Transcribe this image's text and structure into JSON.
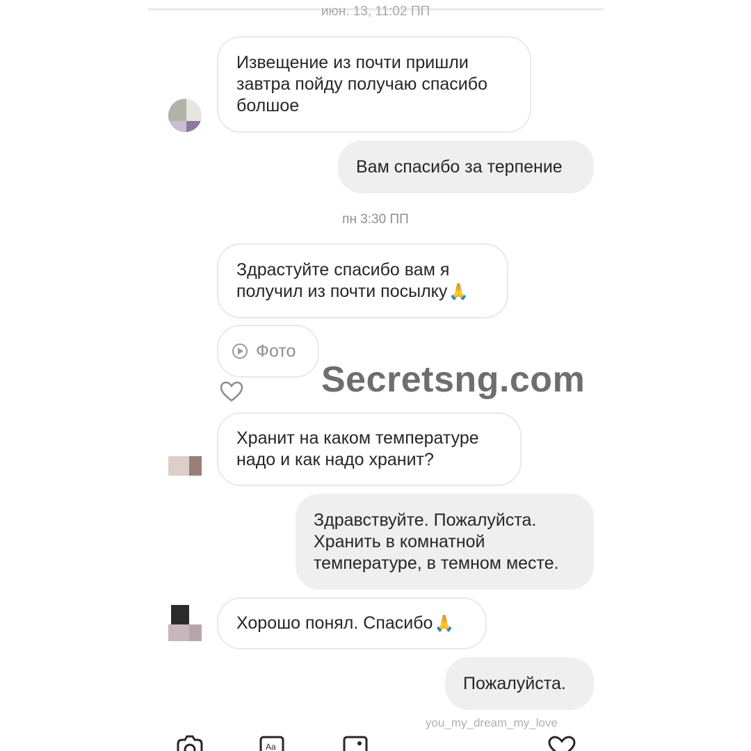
{
  "timestamps": {
    "top_cut": "июн. 13, 11:02 ПП",
    "second": "пн 3:30 ПП"
  },
  "messages": [
    {
      "from": "them",
      "lines": [
        "Извещение из почти пришли",
        "завтра пойду получаю спасибо",
        "болшое"
      ]
    },
    {
      "from": "me",
      "lines": [
        "Вам спасибо за терпение"
      ]
    },
    {
      "from": "them",
      "lines": [
        "Здрастуйте спасибо вам я",
        "получил из почти посылку"
      ],
      "emoji": "🙏"
    },
    {
      "from": "them",
      "type": "photo",
      "label": "Фото"
    },
    {
      "from": "them",
      "lines": [
        "Хранит на каком температуре",
        "надо и как надо хранит?"
      ]
    },
    {
      "from": "me",
      "lines": [
        "Здравствуйте. Пожалуйста.",
        "Хранить в комнатной",
        "температуре, в темном месте."
      ]
    },
    {
      "from": "them",
      "lines": [
        "Хорошо понял. Спасибо"
      ],
      "emoji": "🙏"
    },
    {
      "from": "me",
      "lines": [
        "Пожалуйста."
      ]
    }
  ],
  "seen_by": "you_my_dream_my_love",
  "watermark": "Secretsng.com",
  "toolbar": {
    "icons": [
      "camera-icon",
      "text-format-icon",
      "gallery-icon",
      "heart-icon"
    ]
  },
  "colors": {
    "incoming_bg": "#ffffff",
    "incoming_border": "#e9e9e9",
    "outgoing_bg": "#efefef",
    "timestamp": "#8e8e8e",
    "watermark": "#6e6e6e"
  }
}
